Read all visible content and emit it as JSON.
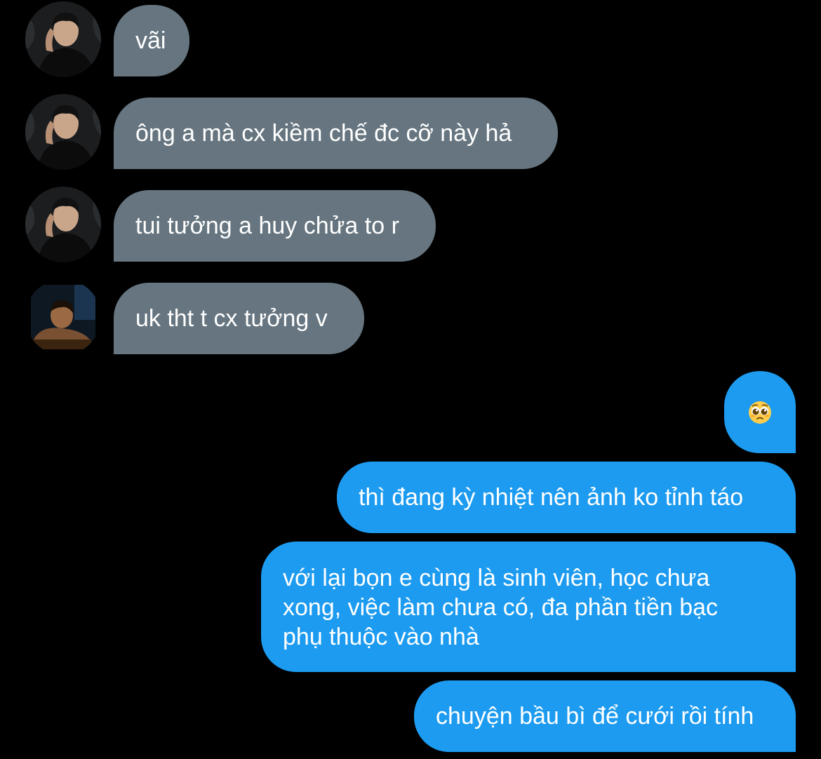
{
  "conversation": {
    "messages": [
      {
        "sender": "other",
        "text": "vãi"
      },
      {
        "sender": "other",
        "text": "ông a mà cx kiềm chế đc cỡ này hả"
      },
      {
        "sender": "other",
        "text": "tui tưởng a huy chửa to r"
      },
      {
        "sender": "other",
        "text": "uk tht t cx tưởng v"
      },
      {
        "sender": "me",
        "emoji": "pleading-face"
      },
      {
        "sender": "me",
        "text": "thì đang kỳ nhiệt nên ảnh ko tỉnh táo"
      },
      {
        "sender": "me",
        "text": "với lại bọn e cùng là sinh viên, học chưa xong, việc làm chưa có, đa phần tiền bạc phụ thuộc vào nhà"
      },
      {
        "sender": "me",
        "text": "chuyện bầu bì để cưới rồi tính"
      }
    ]
  },
  "colors": {
    "background": "#000000",
    "incoming_bubble": "#66757f",
    "outgoing_bubble": "#1d9bf0",
    "text": "#ffffff"
  }
}
